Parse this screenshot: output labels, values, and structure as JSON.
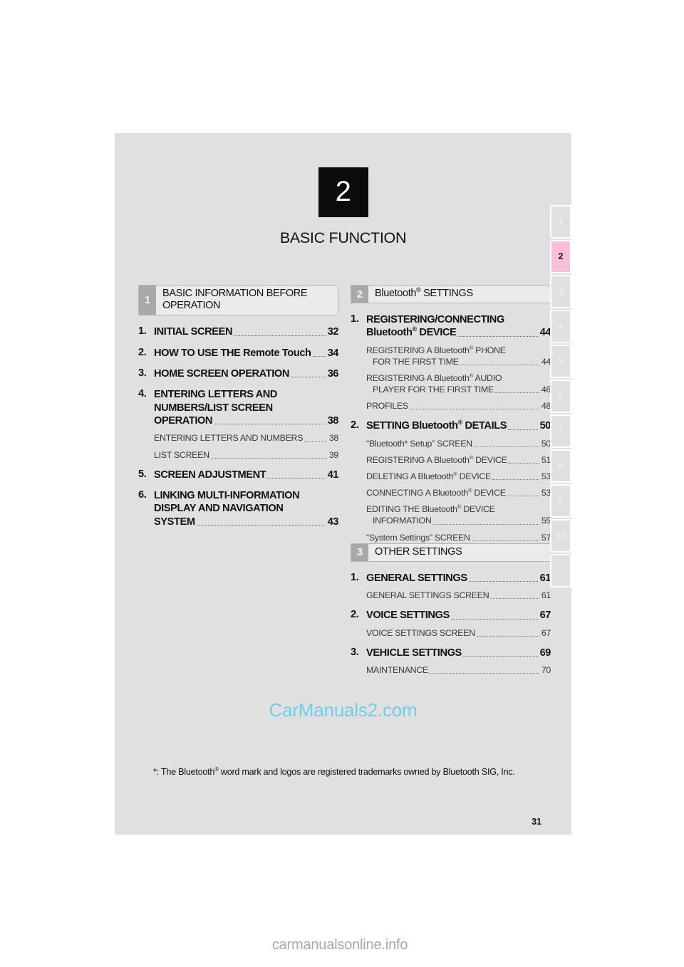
{
  "chapter": {
    "number": "2",
    "title": "BASIC FUNCTION"
  },
  "sections": [
    {
      "number": "1",
      "label": "BASIC INFORMATION BEFORE OPERATION",
      "column": "left",
      "entries": [
        {
          "num": "1.",
          "lines": [
            "INITIAL SCREEN"
          ],
          "page": "32",
          "subs": []
        },
        {
          "num": "2.",
          "lines": [
            "HOW TO USE THE "
          ],
          "mixed_suffix": "Remote Touch",
          "page": "34",
          "subs": []
        },
        {
          "num": "3.",
          "lines": [
            "HOME SCREEN OPERATION"
          ],
          "page": "36",
          "subs": []
        },
        {
          "num": "4.",
          "lines": [
            "ENTERING LETTERS AND",
            "NUMBERS/LIST SCREEN",
            "OPERATION"
          ],
          "page": "38",
          "subs": [
            {
              "lines": [
                "ENTERING LETTERS AND NUMBERS"
              ],
              "page": "38"
            },
            {
              "lines": [
                "LIST SCREEN"
              ],
              "page": "39"
            }
          ]
        },
        {
          "num": "5.",
          "lines": [
            "SCREEN ADJUSTMENT"
          ],
          "page": "41",
          "subs": []
        },
        {
          "num": "6.",
          "lines": [
            "LINKING MULTI-INFORMATION",
            "DISPLAY AND NAVIGATION",
            "SYSTEM"
          ],
          "page": "43",
          "subs": []
        }
      ]
    },
    {
      "number": "2",
      "label": "Bluetooth® SETTINGS",
      "column": "right",
      "entries": [
        {
          "num": "1.",
          "lines": [
            "REGISTERING/CONNECTING",
            "Bluetooth® DEVICE"
          ],
          "page": "44",
          "subs": [
            {
              "lines": [
                "REGISTERING A Bluetooth® PHONE",
                "FOR THE FIRST TIME"
              ],
              "page": "44"
            },
            {
              "lines": [
                "REGISTERING A Bluetooth® AUDIO",
                "PLAYER FOR THE FIRST TIME"
              ],
              "page": "46"
            },
            {
              "lines": [
                "PROFILES"
              ],
              "page": "48"
            }
          ]
        },
        {
          "num": "2.",
          "lines": [
            "SETTING Bluetooth® DETAILS"
          ],
          "page": "50",
          "subs": [
            {
              "lines": [
                "“Bluetooth* Setup” SCREEN"
              ],
              "page": "50"
            },
            {
              "lines": [
                "REGISTERING A Bluetooth® DEVICE"
              ],
              "page": "51"
            },
            {
              "lines": [
                "DELETING A Bluetooth® DEVICE"
              ],
              "page": "53"
            },
            {
              "lines": [
                "CONNECTING A Bluetooth® DEVICE"
              ],
              "page": "53"
            },
            {
              "lines": [
                "EDITING THE Bluetooth® DEVICE",
                "INFORMATION"
              ],
              "page": "55"
            },
            {
              "lines": [
                "“System Settings” SCREEN"
              ],
              "page": "57"
            }
          ]
        }
      ]
    },
    {
      "number": "3",
      "label": "OTHER SETTINGS",
      "column": "right",
      "entries": [
        {
          "num": "1.",
          "lines": [
            "GENERAL SETTINGS"
          ],
          "page": "61",
          "subs": [
            {
              "lines": [
                "GENERAL SETTINGS SCREEN"
              ],
              "page": "61"
            }
          ]
        },
        {
          "num": "2.",
          "lines": [
            "VOICE SETTINGS"
          ],
          "page": "67",
          "subs": [
            {
              "lines": [
                "VOICE SETTINGS SCREEN"
              ],
              "page": "67"
            }
          ]
        },
        {
          "num": "3.",
          "lines": [
            "VEHICLE SETTINGS"
          ],
          "page": "69",
          "subs": [
            {
              "lines": [
                "MAINTENANCE"
              ],
              "page": "70"
            }
          ]
        }
      ]
    }
  ],
  "footnote": "*: The Bluetooth® word mark and logos are registered trademarks owned by Bluetooth SIG, Inc.",
  "page_number": "31",
  "watermark_main": "CarManuals2.com",
  "watermark_bottom": "carmanualsonline.info",
  "tabs": [
    {
      "label": "1",
      "active": false
    },
    {
      "label": "2",
      "active": true
    },
    {
      "label": "3",
      "active": false
    },
    {
      "label": "4",
      "active": false
    },
    {
      "label": "5",
      "active": false
    },
    {
      "label": "6",
      "active": false
    },
    {
      "label": "7",
      "active": false
    },
    {
      "label": "8",
      "active": false
    },
    {
      "label": "9",
      "active": false
    },
    {
      "label": "10",
      "active": false
    },
    {
      "label": "",
      "active": false
    }
  ],
  "colors": {
    "page_background": "#e0e0e0",
    "chapter_badge": "#0b0b0b",
    "section_number_box": "#a8a8a8",
    "section_label_box": "#ebebeb",
    "active_tab": "#f9bfd9",
    "watermark": "#6ecdf0"
  }
}
